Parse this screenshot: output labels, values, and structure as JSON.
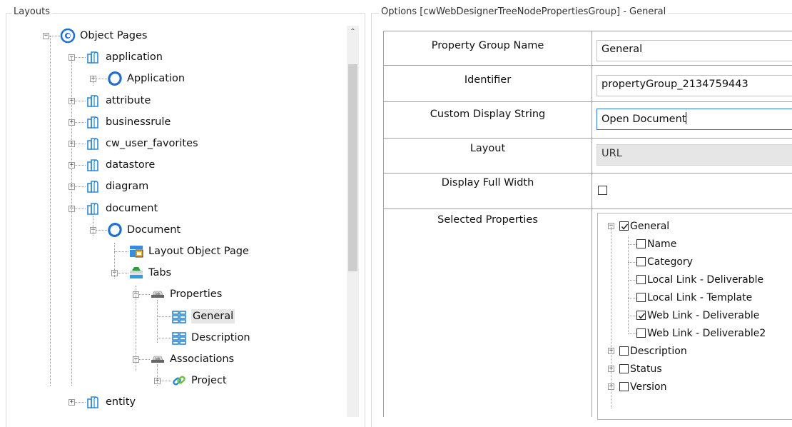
{
  "left_panel": {
    "title": "Layouts",
    "tree": [
      {
        "label": "Object Pages",
        "icon": "object-pages-icon",
        "expander": "-"
      },
      {
        "label": "application",
        "icon": "object-folder-icon",
        "expander": "-"
      },
      {
        "label": "Application",
        "icon": "object-ring-icon",
        "expander": "+"
      },
      {
        "label": "attribute",
        "icon": "object-folder-icon",
        "expander": "+"
      },
      {
        "label": "businessrule",
        "icon": "object-folder-icon",
        "expander": "+"
      },
      {
        "label": "cw_user_favorites",
        "icon": "object-folder-icon",
        "expander": "+"
      },
      {
        "label": "datastore",
        "icon": "object-folder-icon",
        "expander": "+"
      },
      {
        "label": "diagram",
        "icon": "object-folder-icon",
        "expander": "+"
      },
      {
        "label": "document",
        "icon": "object-folder-icon",
        "expander": "-"
      },
      {
        "label": "Document",
        "icon": "object-ring-icon",
        "expander": "-"
      },
      {
        "label": "Layout Object Page",
        "icon": "layout-page-icon",
        "expander": ""
      },
      {
        "label": "Tabs",
        "icon": "tabs-icon",
        "expander": "-"
      },
      {
        "label": "Properties",
        "icon": "tab-icon",
        "expander": "-"
      },
      {
        "label": "General",
        "icon": "property-group-icon",
        "expander": ""
      },
      {
        "label": "Description",
        "icon": "property-group-icon",
        "expander": ""
      },
      {
        "label": "Associations",
        "icon": "tab-icon",
        "expander": "-"
      },
      {
        "label": "Project",
        "icon": "association-link-icon",
        "expander": "+"
      },
      {
        "label": "entity",
        "icon": "object-folder-icon",
        "expander": "+"
      }
    ]
  },
  "right_panel": {
    "title": "Options [cwWebDesignerTreeNodePropertiesGroup] - General",
    "rows": [
      {
        "label": "Property Group Name",
        "value": "General"
      },
      {
        "label": "Identifier",
        "value": "propertyGroup_2134759443"
      },
      {
        "label": "Custom Display String",
        "value": "Open Document"
      },
      {
        "label": "Layout",
        "value": "URL"
      },
      {
        "label": "Display Full Width",
        "value": ""
      },
      {
        "label": "Selected Properties",
        "value": ""
      }
    ],
    "selected_properties": [
      {
        "label": "General",
        "checked": true,
        "expander": "-"
      },
      {
        "label": "Name",
        "checked": false,
        "expander": ""
      },
      {
        "label": "Category",
        "checked": false,
        "expander": ""
      },
      {
        "label": "Local Link - Deliverable",
        "checked": false,
        "expander": ""
      },
      {
        "label": "Local Link - Template",
        "checked": false,
        "expander": ""
      },
      {
        "label": "Web Link - Deliverable",
        "checked": true,
        "expander": ""
      },
      {
        "label": "Web Link - Deliverable2",
        "checked": false,
        "expander": ""
      },
      {
        "label": "Description",
        "checked": false,
        "expander": "+"
      },
      {
        "label": "Status",
        "checked": false,
        "expander": "+"
      },
      {
        "label": "Version",
        "checked": false,
        "expander": "+"
      }
    ]
  },
  "colors": {
    "ring_blue": "#1f6fd1",
    "folder_blue": "#2b86d8",
    "link_green": "#6cbf3b",
    "selected_bg": "#e6e6e6"
  }
}
